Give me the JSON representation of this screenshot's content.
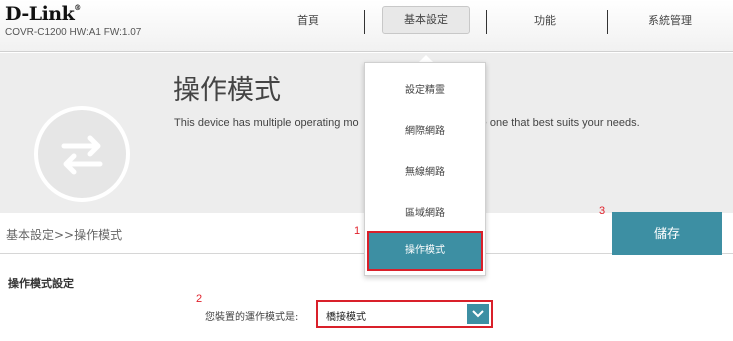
{
  "header": {
    "brand": "D-Link",
    "model_info": "COVR-C1200 HW:A1 FW:1.07",
    "nav": [
      {
        "label": "首頁"
      },
      {
        "label": "基本設定"
      },
      {
        "label": "功能"
      },
      {
        "label": "系統管理"
      }
    ]
  },
  "banner": {
    "title": "操作模式",
    "description": "This device has multiple operating modes. Please select the one that suits your needs.",
    "desc_left": "This device has multiple operating mo",
    "desc_right": "e one that best suits your needs."
  },
  "breadcrumb": "基本設定>>操作模式",
  "save_label": "儲存",
  "settings": {
    "section_title": "操作模式設定",
    "mode_label": "您裝置的運作模式是:",
    "mode_value": "橋接模式"
  },
  "dropdown_menu": {
    "items": [
      {
        "label": "設定精靈"
      },
      {
        "label": "網際網路"
      },
      {
        "label": "無線網路"
      },
      {
        "label": "區域網路"
      },
      {
        "label": "操作模式"
      }
    ],
    "selected": "操作模式"
  },
  "annotations": {
    "marker_1": "1",
    "marker_2": "2",
    "marker_3": "3"
  },
  "colors": {
    "accent": "#3d8fa3",
    "highlight_border": "#d9202a"
  }
}
